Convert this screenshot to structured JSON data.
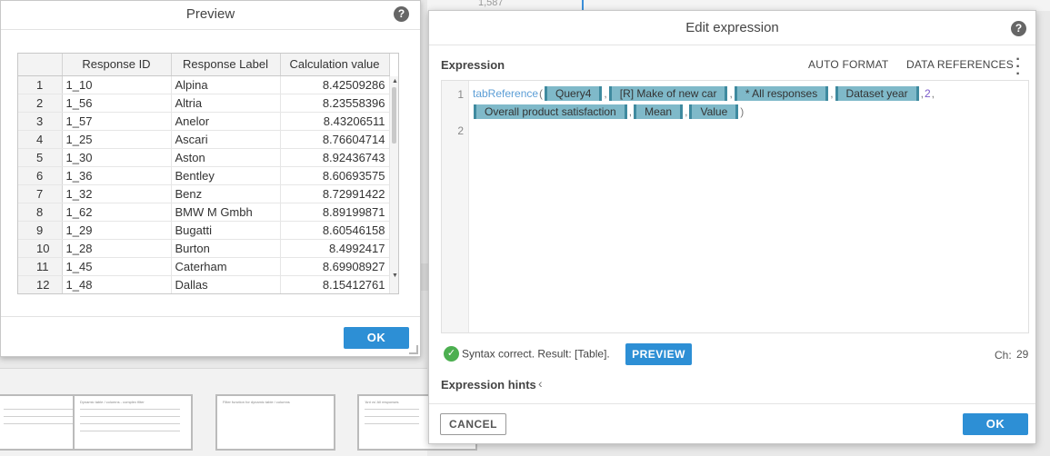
{
  "background": {
    "top_value": "1,587",
    "thumbnails": [
      "",
      "Dynamic table / columns - complex filter",
      "Filter function for dynamic table / columns",
      "'Ant vs' All responses"
    ]
  },
  "preview_dialog": {
    "title": "Preview",
    "help": "?",
    "columns": [
      "",
      "Response ID",
      "Response Label",
      "Calculation value"
    ],
    "rows": [
      {
        "n": "1",
        "id": "1_10",
        "label": "Alpina",
        "value": "8.42509286"
      },
      {
        "n": "2",
        "id": "1_56",
        "label": "Altria",
        "value": "8.23558396"
      },
      {
        "n": "3",
        "id": "1_57",
        "label": "Anelor",
        "value": "8.43206511"
      },
      {
        "n": "4",
        "id": "1_25",
        "label": "Ascari",
        "value": "8.76604714"
      },
      {
        "n": "5",
        "id": "1_30",
        "label": "Aston",
        "value": "8.92436743"
      },
      {
        "n": "6",
        "id": "1_36",
        "label": "Bentley",
        "value": "8.60693575"
      },
      {
        "n": "7",
        "id": "1_32",
        "label": "Benz",
        "value": "8.72991422"
      },
      {
        "n": "8",
        "id": "1_62",
        "label": "BMW M Gmbh",
        "value": "8.89199871"
      },
      {
        "n": "9",
        "id": "1_29",
        "label": "Bugatti",
        "value": "8.60546158"
      },
      {
        "n": "10",
        "id": "1_28",
        "label": "Burton",
        "value": "8.4992417"
      },
      {
        "n": "11",
        "id": "1_45",
        "label": "Caterham",
        "value": "8.69908927"
      },
      {
        "n": "12",
        "id": "1_48",
        "label": "Dallas",
        "value": "8.15412761"
      }
    ],
    "ok_label": "OK"
  },
  "edit_dialog": {
    "title": "Edit expression",
    "help": "?",
    "expression_label": "Expression",
    "auto_format_label": "AUTO FORMAT",
    "data_references_label": "DATA REFERENCES",
    "line_numbers": [
      "1",
      "2"
    ],
    "code": {
      "function": "tabReference",
      "open_paren": "(",
      "tokens_line1": [
        "Query4",
        "[R] Make of new car",
        "* All responses",
        "Dataset year"
      ],
      "number_arg": "2",
      "tokens_line2": [
        "Overall product satisfaction",
        "Mean",
        "Value"
      ],
      "comma": ",",
      "close_paren": ")"
    },
    "status_text": "Syntax correct. Result: [Table].",
    "preview_label": "PREVIEW",
    "ch_label": "Ch:",
    "ch_value": "29",
    "hints_label": "Expression hints",
    "cancel_label": "CANCEL",
    "ok_label": "OK"
  }
}
